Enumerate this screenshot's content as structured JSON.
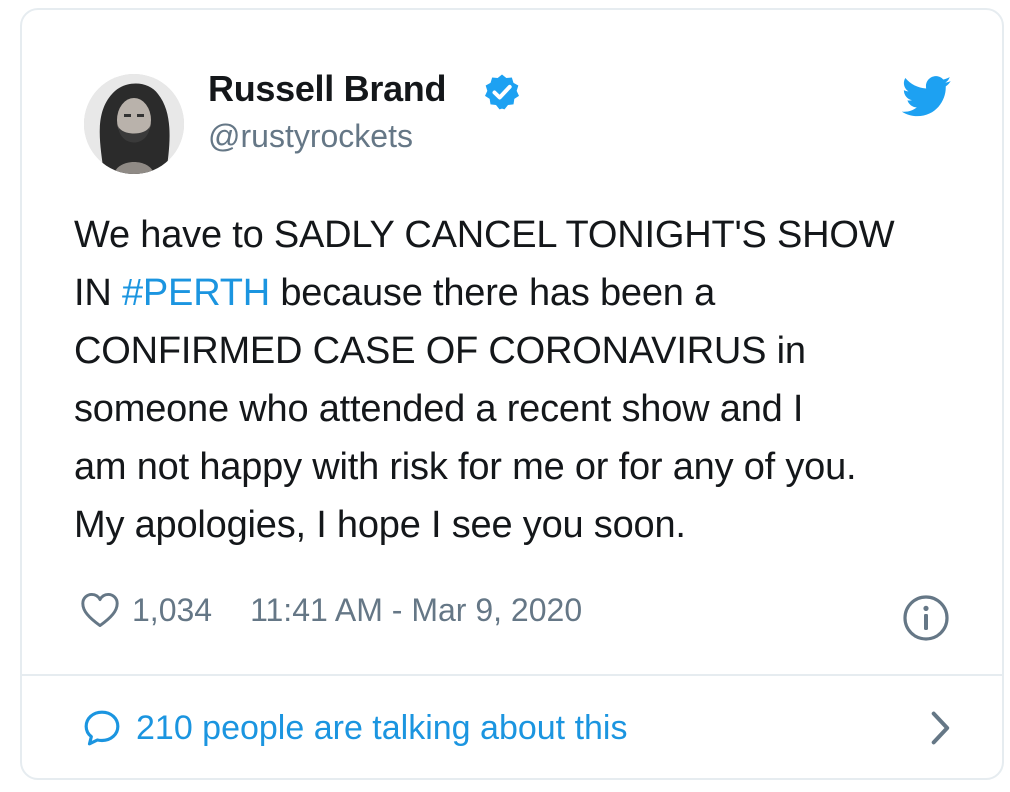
{
  "tweet": {
    "author": {
      "name": "Russell Brand",
      "handle": "@rustyrockets",
      "verified": true
    },
    "text": {
      "line1": "We have to SADLY CANCEL TONIGHT'S SHOW",
      "line2_prefix": "IN ",
      "hashtag": "#PERTH",
      "line2_suffix": " because there has been a",
      "line3": "CONFIRMED CASE OF CORONAVIRUS in",
      "line4": "someone who attended a recent show and I",
      "line5": "am not happy with risk for me or for any of you.",
      "line6": "My apologies, I hope I see you soon."
    },
    "likes": "1,034",
    "timestamp": "11:41 AM - Mar 9, 2020",
    "conversation": "210 people are talking about this"
  },
  "icons": {
    "verified": "verified-badge-icon",
    "brand": "twitter-bird-icon",
    "like": "heart-icon",
    "info": "info-icon",
    "reply": "speech-bubble-icon",
    "more": "chevron-right-icon"
  },
  "colors": {
    "twitter_blue": "#1da1f2",
    "link_blue": "#1b95e0",
    "text": "#14171a",
    "muted": "#657786",
    "border": "#e6ecf0"
  }
}
